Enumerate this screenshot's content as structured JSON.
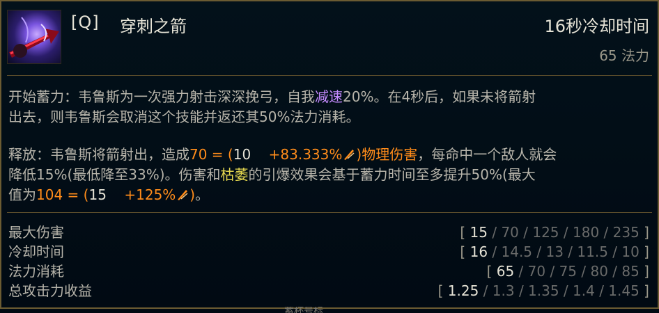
{
  "ability": {
    "key": "[Q]",
    "name": "穿刺之箭",
    "cooldown_text": "16秒冷却时间",
    "cost_text": "65 法力"
  },
  "description": {
    "charge_prefix": "开始蓄力：韦鲁斯为一次强力射击深深挽弓，自我",
    "charge_slow": "减速",
    "charge_rest_line1": "20%。在4秒后，如果未将箭射",
    "charge_line2": "出去，则韦鲁斯会取消这个技能并返还其50%法力消耗。",
    "release_prefix": "释放：韦鲁斯将箭射出，造成",
    "damage_total": "70 =",
    "damage_base": "10",
    "damage_ratio": "+83.333%",
    "damage_type": "物理伤害",
    "release_after_damage": "，每命中一个敌人就会",
    "release_line2_prefix": "降低15%(最低降至33%)。伤害和",
    "blight": "枯萎",
    "release_line2_rest": "的引爆效果会基于蓄力时间至多提升50%(最大",
    "max_prefix": "值为",
    "max_total": "104 =",
    "max_base": "15",
    "max_ratio": "+125%",
    "max_suffix": "。"
  },
  "stats": [
    {
      "label": "最大伤害",
      "current": "15",
      "ranks": [
        "70",
        "125",
        "180",
        "235"
      ]
    },
    {
      "label": "冷却时间",
      "current": "16",
      "ranks": [
        "14.5",
        "13",
        "11.5",
        "10"
      ]
    },
    {
      "label": "法力消耗",
      "current": "65",
      "ranks": [
        "70",
        "75",
        "80",
        "85"
      ]
    },
    {
      "label": "总攻击力收益",
      "current": "1.25",
      "ranks": [
        "1.3",
        "1.35",
        "1.4",
        "1.45"
      ]
    }
  ],
  "bottom_hint": "蓄杯号标",
  "colors": {
    "gold_border": "#6b5b32",
    "slow": "#c58bff",
    "physical": "#ff8c1a",
    "blight": "#e5d84f"
  },
  "icons": [
    "ability-arrow-icon",
    "attack-damage-icon"
  ]
}
